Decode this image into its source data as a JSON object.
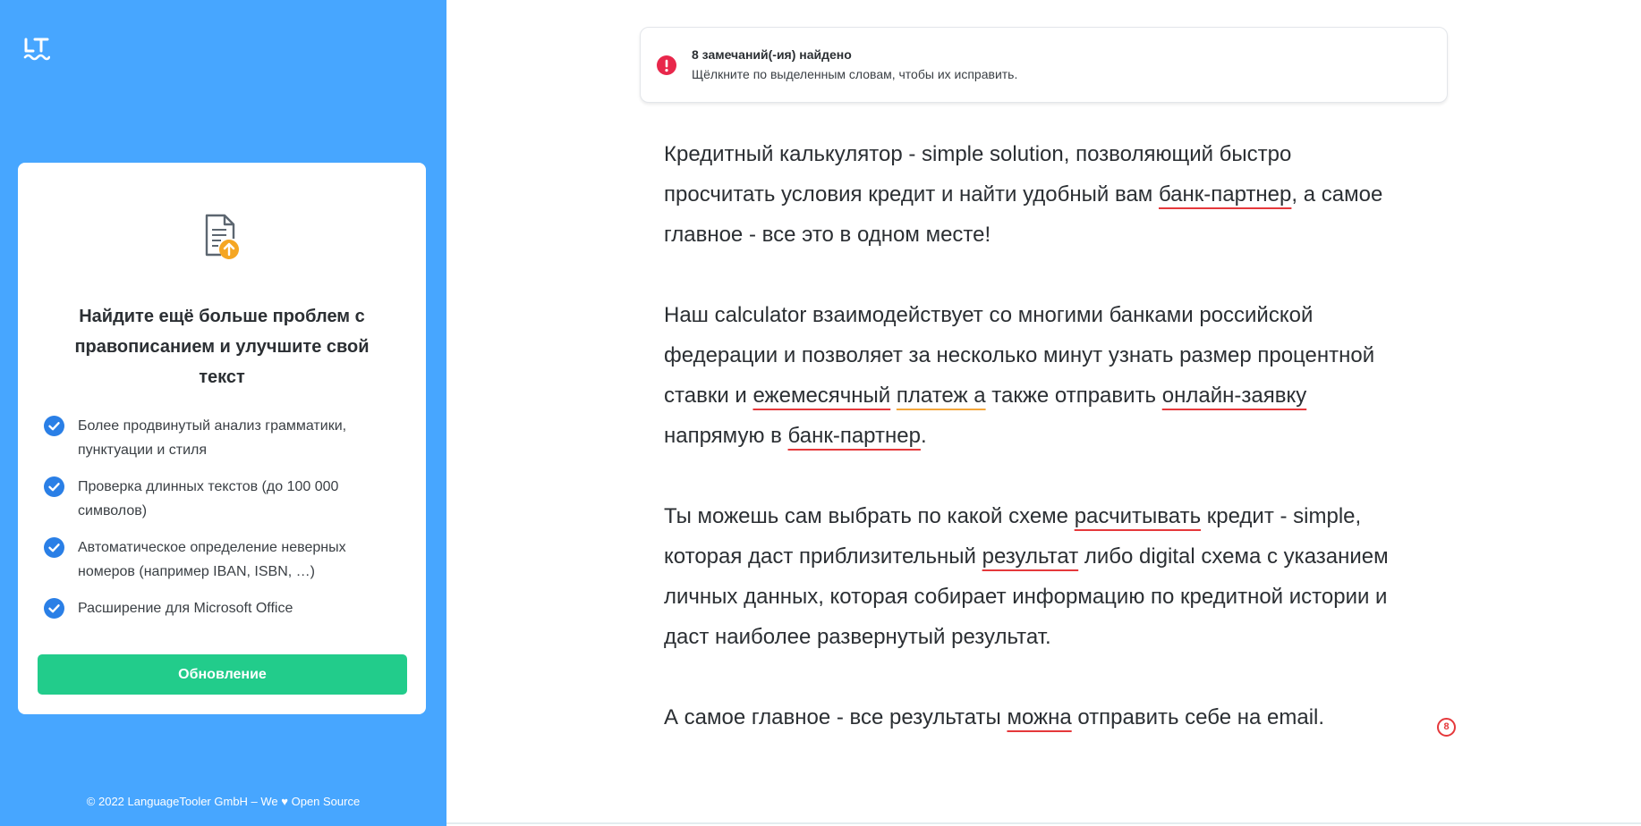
{
  "logo": {
    "text": "LT",
    "icon": "languagetool-logo"
  },
  "colors": {
    "sidebar_bg": "#47a6ff",
    "upgrade_button": "#22cc8b",
    "check": "#2a7fe6",
    "error_underline": "#e5383b",
    "style_underline": "#f3a53a",
    "alert": "#e8274b",
    "upload_badge": "#f5a623"
  },
  "sidebar": {
    "card": {
      "icon": "document-upload-icon",
      "title": "Найдите ещё больше проблем с правописанием и улучшите свой текст",
      "check_icon": "check-circle-icon",
      "features": [
        "Более продвинутый анализ грамматики, пунктуации и стиля",
        "Проверка длинных текстов (до 100 000 символов)",
        "Автоматическое определение неверных номеров (например IBAN, ISBN, …)",
        "Расширение для Microsoft Office"
      ],
      "upgrade_button": "Обновление"
    },
    "footer": "© 2022 LanguageTooler GmbH – We ♥ Open Source"
  },
  "notice": {
    "icon": "alert-icon",
    "title": "8 замечаний(-ия) найдено",
    "subtitle": "Щёлкните по выделенным словам, чтобы их исправить."
  },
  "editor": {
    "issue_count": "8",
    "paragraphs": [
      {
        "lines": [
          [
            {
              "t": "Кредитный калькулятор - simple solution, позволяющий быстро"
            }
          ],
          [
            {
              "t": "просчитать условия кредит и найти удобный вам "
            },
            {
              "t": "банк-партнер",
              "m": "error"
            },
            {
              "t": ", а самое"
            }
          ],
          [
            {
              "t": "главное - все это в одном месте!"
            }
          ]
        ]
      },
      {
        "lines": [
          [
            {
              "t": "Наш calculator взаимодействует со многими банками российской"
            }
          ],
          [
            {
              "t": "федерации и позволяет за несколько минут узнать размер процентной"
            }
          ],
          [
            {
              "t": "ставки и "
            },
            {
              "t": "ежемесячный",
              "m": "error"
            },
            {
              "t": " "
            },
            {
              "t": "платеж а",
              "m": "style"
            },
            {
              "t": " также отправить "
            },
            {
              "t": "онлайн-заявку",
              "m": "error"
            }
          ],
          [
            {
              "t": "напрямую в "
            },
            {
              "t": "банк-партнер",
              "m": "error"
            },
            {
              "t": "."
            }
          ]
        ]
      },
      {
        "lines": [
          [
            {
              "t": "Ты можешь сам выбрать по какой схеме "
            },
            {
              "t": "расчитывать",
              "m": "error"
            },
            {
              "t": " кредит - simple,"
            }
          ],
          [
            {
              "t": "которая даст приблизительный "
            },
            {
              "t": "результат",
              "m": "error"
            },
            {
              "t": " либо digital схема с указанием"
            }
          ],
          [
            {
              "t": "личных данных, которая собирает информацию по кредитной истории и"
            }
          ],
          [
            {
              "t": "даст наиболее развернутый результат."
            }
          ]
        ]
      },
      {
        "lines": [
          [
            {
              "t": "А самое главное - все результаты "
            },
            {
              "t": "можна",
              "m": "error"
            },
            {
              "t": " отправить себе на email."
            }
          ]
        ]
      }
    ]
  }
}
